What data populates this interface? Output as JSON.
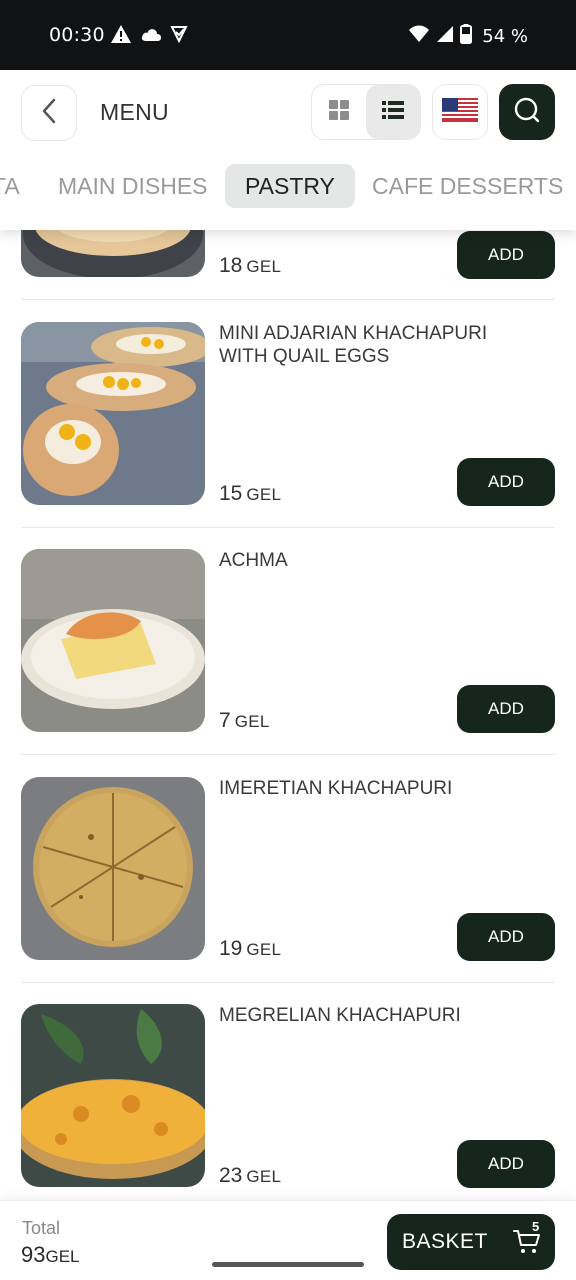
{
  "status_bar": {
    "time": "00:30",
    "battery": "54 %",
    "icons": [
      "alert-icon",
      "cloud-icon",
      "check-shield-icon",
      "wifi-icon",
      "signal-icon",
      "battery-icon"
    ]
  },
  "header": {
    "title": "MENU",
    "flag": "us-flag-icon",
    "view_modes": [
      "grid-view-icon",
      "list-view-icon"
    ],
    "active_view": "list"
  },
  "tabs": [
    {
      "label": "TA",
      "active": false
    },
    {
      "label": "MAIN DISHES",
      "active": false
    },
    {
      "label": "PASTRY",
      "active": true
    },
    {
      "label": "CAFE DESSERTS",
      "active": false
    }
  ],
  "items": [
    {
      "name": "",
      "price": "18",
      "currency": "GEL",
      "add_label": "ADD"
    },
    {
      "name": "MINI ADJARIAN KHACHAPURI WITH QUAIL EGGS",
      "price": "15",
      "currency": "GEL",
      "add_label": "ADD"
    },
    {
      "name": "ACHMA",
      "price": "7",
      "currency": "GEL",
      "add_label": "ADD"
    },
    {
      "name": "IMERETIAN KHACHAPURI",
      "price": "19",
      "currency": "GEL",
      "add_label": "ADD"
    },
    {
      "name": "MEGRELIAN KHACHAPURI",
      "price": "23",
      "currency": "GEL",
      "add_label": "ADD"
    }
  ],
  "footer": {
    "total_label": "Total",
    "total_value": "93",
    "total_currency": "GEL",
    "basket_label": "BASKET",
    "basket_count": "5"
  },
  "colors": {
    "accent_dark_green": "#17261d",
    "status_bar": "#111214",
    "active_tab_bg": "#e5e7e6"
  }
}
